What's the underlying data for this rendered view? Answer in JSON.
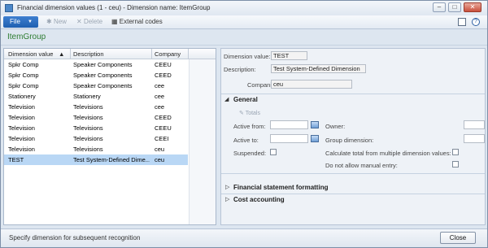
{
  "window": {
    "title": "Financial dimension values (1 - ceu) - Dimension name: ItemGroup"
  },
  "toolbar": {
    "file_label": "File",
    "new_label": "New",
    "delete_label": "Delete",
    "external_codes_label": "External codes"
  },
  "header": {
    "title": "ItemGroup"
  },
  "grid": {
    "columns": [
      "Dimension value",
      "Description",
      "Company"
    ],
    "rows": [
      {
        "value": "Spkr Comp",
        "description": "Speaker Components",
        "company": "CEEU"
      },
      {
        "value": "Spkr Comp",
        "description": "Speaker Components",
        "company": "CEED"
      },
      {
        "value": "Spkr Comp",
        "description": "Speaker Components",
        "company": "cee"
      },
      {
        "value": "Stationery",
        "description": "Stationery",
        "company": "cee"
      },
      {
        "value": "Television",
        "description": "Televisions",
        "company": "cee"
      },
      {
        "value": "Television",
        "description": "Televisions",
        "company": "CEED"
      },
      {
        "value": "Television",
        "description": "Televisions",
        "company": "CEEU"
      },
      {
        "value": "Television",
        "description": "Televisions",
        "company": "CEEI"
      },
      {
        "value": "Television",
        "description": "Televisions",
        "company": "ceu"
      },
      {
        "value": "TEST",
        "description": "Test System-Defined Dime...",
        "company": "ceu"
      }
    ]
  },
  "detail": {
    "dimension_value_label": "Dimension value:",
    "dimension_value": "TEST",
    "description_label": "Description:",
    "description": "Test System-Defined Dimension",
    "companies_label": "Companies:",
    "companies": "ceu",
    "general_title": "General",
    "totals_label": "Totals",
    "active_from_label": "Active from:",
    "active_to_label": "Active to:",
    "suspended_label": "Suspended:",
    "owner_label": "Owner:",
    "group_dimension_label": "Group dimension:",
    "calc_total_label": "Calculate total from multiple dimension values:",
    "no_manual_label": "Do not allow manual entry:",
    "financial_statement_title": "Financial statement formatting",
    "cost_accounting_title": "Cost accounting"
  },
  "status": {
    "text": "Specify dimension for subsequent recognition",
    "close_label": "Close"
  },
  "colors": {
    "header_green": "#2e7d32",
    "selection": "#b9d7f5",
    "file_blue": "#2a6cc0"
  }
}
